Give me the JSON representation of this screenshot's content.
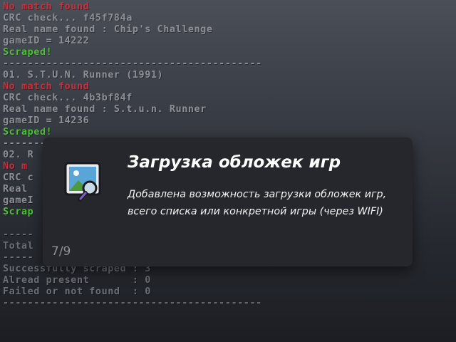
{
  "log_lines": [
    {
      "text": "No match found",
      "color": "#c5313d"
    },
    {
      "text": "CRC check... f45f784a",
      "color": "#8c9096"
    },
    {
      "text": "Real name found : Chip's Challenge",
      "color": "#8c9096"
    },
    {
      "text": "gameID = 14222",
      "color": "#8c9096"
    },
    {
      "text": "Scraped!",
      "color": "#4fbf3a"
    },
    {
      "text": "------------------------------------------",
      "color": "#8c9096"
    },
    {
      "text": "01. S.T.U.N. Runner (1991)",
      "color": "#8c9096"
    },
    {
      "text": "No match found",
      "color": "#c5313d"
    },
    {
      "text": "CRC check... 4b3bf84f",
      "color": "#8c9096"
    },
    {
      "text": "Real name found : S.t.u.n. Runner",
      "color": "#8c9096"
    },
    {
      "text": "gameID = 14236",
      "color": "#8c9096"
    },
    {
      "text": "Scraped!",
      "color": "#4fbf3a"
    },
    {
      "text": "------------------------------------------",
      "color": "#8c9096"
    },
    {
      "text": "02. R",
      "color": "#8c9096"
    },
    {
      "text": "No m",
      "color": "#c5313d"
    },
    {
      "text": "CRC c",
      "color": "#8c9096"
    },
    {
      "text": "Real",
      "color": "#8c9096"
    },
    {
      "text": "gameI",
      "color": "#8c9096"
    },
    {
      "text": "Scrap",
      "color": "#4fbf3a"
    },
    {
      "text": "",
      "color": "#8c9096"
    },
    {
      "text": "-----",
      "color": "#6a6e75"
    },
    {
      "text": "Total",
      "color": "#6a6e75"
    },
    {
      "text": "-----",
      "color": "#6a6e75"
    },
    {
      "text": "Successfully scraped : 3",
      "color": "#6a6e75"
    },
    {
      "text": "Alread present       : 0",
      "color": "#6a6e75"
    },
    {
      "text": "Failed or not found  : 0",
      "color": "#6a6e75"
    },
    {
      "text": "------------------------------------------",
      "color": "#6a6e75"
    }
  ],
  "toast": {
    "title": "Загрузка обложек игр",
    "description": "Добавлена возможность загрузки обложек игр, всего списка или конкретной игры (через WIFI)",
    "counter": "7/9",
    "icon": "image-search-icon",
    "background": "#25272c"
  }
}
